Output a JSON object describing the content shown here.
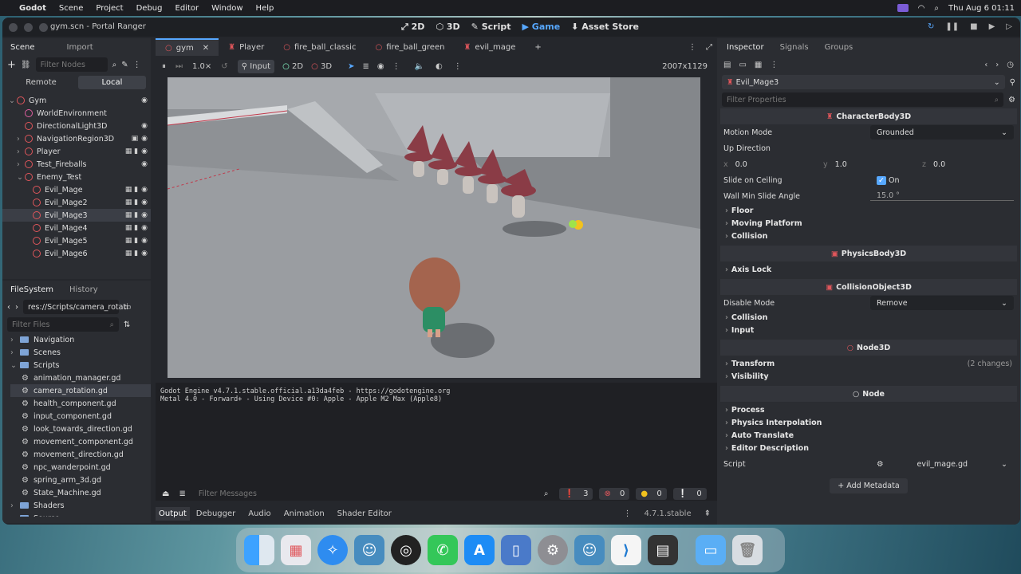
{
  "menubar": {
    "app": "Godot",
    "items": [
      "Scene",
      "Project",
      "Debug",
      "Editor",
      "Window",
      "Help"
    ],
    "clock": "Thu Aug 6  01:11"
  },
  "window": {
    "title": "gym.scn - Portal Ranger",
    "modes": [
      "2D",
      "3D",
      "Script",
      "Game",
      "Asset Store"
    ],
    "active_mode": "Game"
  },
  "scene_dock": {
    "tabs": [
      "Scene",
      "Import"
    ],
    "filter_placeholder": "Filter Nodes",
    "remote": "Remote",
    "local": "Local",
    "nodes": [
      {
        "label": "Gym",
        "color": "#e0565b"
      },
      {
        "label": "WorldEnvironment",
        "color": "#e05fa0"
      },
      {
        "label": "DirectionalLight3D",
        "color": "#e0565b"
      },
      {
        "label": "NavigationRegion3D",
        "color": "#e0565b"
      },
      {
        "label": "Player",
        "color": "#e0565b"
      },
      {
        "label": "Test_Fireballs",
        "color": "#e0565b"
      },
      {
        "label": "Enemy_Test",
        "color": "#e0565b"
      },
      {
        "label": "Evil_Mage",
        "color": "#e0565b"
      },
      {
        "label": "Evil_Mage2",
        "color": "#e0565b"
      },
      {
        "label": "Evil_Mage3",
        "color": "#e0565b"
      },
      {
        "label": "Evil_Mage4",
        "color": "#e0565b"
      },
      {
        "label": "Evil_Mage5",
        "color": "#e0565b"
      },
      {
        "label": "Evil_Mage6",
        "color": "#e0565b"
      }
    ]
  },
  "fs_dock": {
    "tabs": [
      "FileSystem",
      "History"
    ],
    "path": "res://Scripts/camera_rotati",
    "filter_placeholder": "Filter Files",
    "folders_top": [
      "Navigation",
      "Scenes",
      "Scripts"
    ],
    "scripts": [
      "animation_manager.gd",
      "camera_rotation.gd",
      "health_component.gd",
      "input_component.gd",
      "look_towards_direction.gd",
      "movement_component.gd",
      "movement_direction.gd",
      "npc_wanderpoint.gd",
      "spring_arm_3d.gd",
      "State_Machine.gd"
    ],
    "folders_bottom": [
      "Shaders",
      "Source"
    ]
  },
  "editor_tabs": [
    "gym",
    "Player",
    "fire_ball_classic",
    "fire_ball_green",
    "evil_mage"
  ],
  "game_toolbar": {
    "speed": "1.0×",
    "input": "Input",
    "m2d": "2D",
    "m3d": "3D",
    "resolution": "2007x1129"
  },
  "console": {
    "lines": [
      "Godot Engine v4.7.1.stable.official.a13da4feb - https://godotengine.org",
      "Metal 4.0 - Forward+ - Using Device #0: Apple - Apple M2 Max (Apple8)"
    ],
    "filter_placeholder": "Filter Messages",
    "counts": [
      "3",
      "0",
      "0",
      "0"
    ]
  },
  "bottom_tabs": [
    "Output",
    "Debugger",
    "Audio",
    "Animation",
    "Shader Editor"
  ],
  "version": "4.7.1.stable",
  "inspector": {
    "tabs": [
      "Inspector",
      "Signals",
      "Groups"
    ],
    "node": "Evil_Mage3",
    "filter_placeholder": "Filter Properties",
    "sec_character": "CharacterBody3D",
    "motion_mode_label": "Motion Mode",
    "motion_mode": "Grounded",
    "up_direction_label": "Up Direction",
    "up_x": "0.0",
    "up_y": "1.0",
    "up_z": "0.0",
    "slide_label": "Slide on Ceiling",
    "slide_val": "On",
    "wall_label": "Wall Min Slide Angle",
    "wall_val": "15.0 °",
    "floor": "Floor",
    "moving_platform": "Moving Platform",
    "collision": "Collision",
    "sec_physics": "PhysicsBody3D",
    "axis_lock": "Axis Lock",
    "sec_collision": "CollisionObject3D",
    "disable_label": "Disable Mode",
    "disable_val": "Remove",
    "collision2": "Collision",
    "input": "Input",
    "sec_node3d": "Node3D",
    "transform": "Transform",
    "transform_changes": "(2 changes)",
    "visibility": "Visibility",
    "sec_node": "Node",
    "process": "Process",
    "physics_interp": "Physics Interpolation",
    "auto_translate": "Auto Translate",
    "editor_desc": "Editor Description",
    "script_label": "Script",
    "script_val": "evil_mage.gd",
    "add_metadata": "Add Metadata"
  },
  "colors": {
    "accent": "#57a8ff",
    "node_red": "#e0565b"
  }
}
